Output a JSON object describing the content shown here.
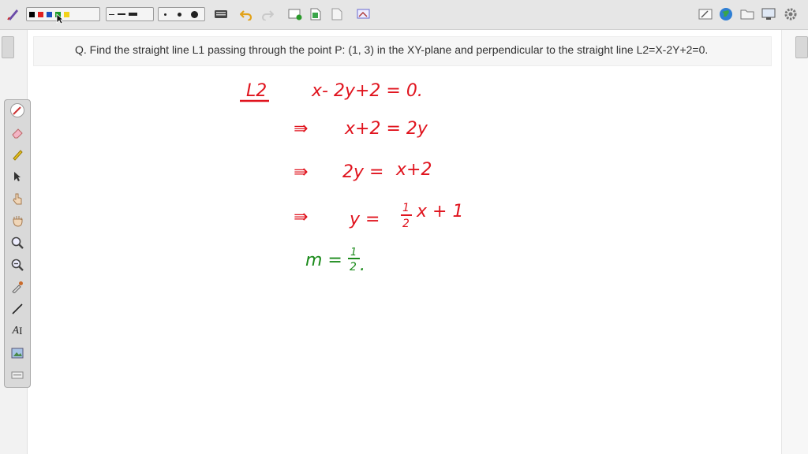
{
  "question": {
    "text": "Q. Find the straight line L1 passing through the point P: (1, 3) in the XY-plane and perpendicular to the straight line L2=X-2Y+2=0."
  },
  "toolbar": {
    "pen_colors": [
      "#000000",
      "#e02020",
      "#1a4ec0",
      "#1a9a2a",
      "#f2d21b"
    ],
    "right_icons": [
      "whiteboard-icon",
      "globe-icon",
      "folder-icon",
      "monitor-icon",
      "settings-icon"
    ]
  },
  "tool_palette": {
    "tools": [
      "pen-icon",
      "eraser-icon",
      "highlighter-icon",
      "select-arrow-icon",
      "hand-pointer-icon",
      "hand-pan-icon",
      "zoom-in-icon",
      "zoom-out-icon",
      "dropper-icon",
      "line-icon",
      "text-tool-icon",
      "image-icon",
      "keyboard-icon"
    ],
    "text_tool_label": "A",
    "text_tool_cursor": "I"
  },
  "handwriting": {
    "colors": {
      "red": "#e0141e",
      "green": "#1a8a1a"
    },
    "heading": "L2",
    "lines": [
      {
        "prefix": "",
        "left": "x- 2y+2 = 0.",
        "right": ""
      },
      {
        "prefix": "⇛",
        "left": "x+2 = 2y",
        "right": ""
      },
      {
        "prefix": "⇛",
        "left": "2y =",
        "right": "x+2"
      },
      {
        "prefix": "⇛",
        "left": "y =",
        "right": "x + 1"
      }
    ],
    "fraction_half": {
      "num": "1",
      "den": "2"
    },
    "slope_line": {
      "left": "m =",
      "num": "1",
      "den": "2",
      "dot": "."
    }
  }
}
